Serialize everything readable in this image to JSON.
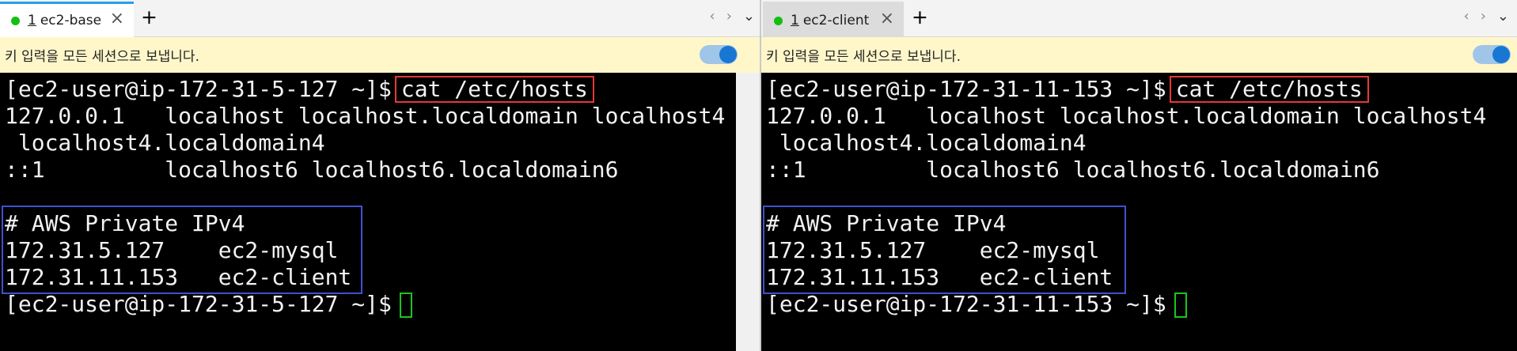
{
  "panes": [
    {
      "tab": {
        "number": "1",
        "name": "ec2-base",
        "close": "×"
      },
      "broadcast_text": "키 입력을 모든 세션으로 보냅니다.",
      "prompt": "[ec2-user@ip-172-31-5-127 ~]$",
      "command": "cat /etc/hosts",
      "lines": [
        "127.0.0.1   localhost localhost.localdomain localhost4",
        " localhost4.localdomain4",
        "::1         localhost6 localhost6.localdomain6",
        "",
        "# AWS Private IPv4",
        "172.31.5.127    ec2-mysql",
        "172.31.11.153   ec2-client"
      ]
    },
    {
      "tab": {
        "number": "1",
        "name": "ec2-client",
        "close": "×"
      },
      "broadcast_text": "키 입력을 모든 세션으로 보냅니다.",
      "prompt": "[ec2-user@ip-172-31-11-153 ~]$",
      "command": "cat /etc/hosts",
      "lines": [
        "127.0.0.1   localhost localhost.localdomain localhost4",
        " localhost4.localdomain4",
        "::1         localhost6 localhost6.localdomain6",
        "",
        "# AWS Private IPv4",
        "172.31.5.127    ec2-mysql",
        "172.31.11.153   ec2-client"
      ]
    }
  ],
  "icons": {
    "new_tab": "+",
    "prev": "‹",
    "next": "›",
    "menu": "⌄"
  },
  "colors": {
    "terminal_bg": "#000000",
    "terminal_fg": "#f2f2f2",
    "command_highlight": "#e53935",
    "section_highlight": "#3f51d0",
    "cursor": "#19c619",
    "broadcast_bg": "#fff7ca",
    "active_tab_accent": "#24a0ea"
  }
}
